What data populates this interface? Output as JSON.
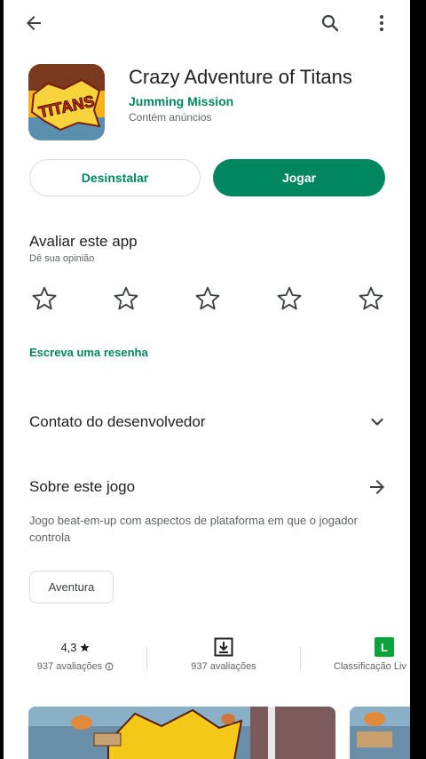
{
  "topbar": {
    "back_icon": "arrow-left-icon",
    "search_icon": "search-icon",
    "more_icon": "more-vert-icon"
  },
  "app": {
    "title": "Crazy Adventure of Titans",
    "developer": "Jumming Mission",
    "ads_note": "Contém anúncios",
    "icon_text": "TITANS"
  },
  "actions": {
    "uninstall_label": "Desinstalar",
    "play_label": "Jogar"
  },
  "rating": {
    "title": "Avaliar este app",
    "subtitle": "Dê sua opinião",
    "star_count": 5,
    "write_review": "Escreva uma resenha"
  },
  "developer_contact": {
    "label": "Contato do desenvolvedor"
  },
  "about": {
    "label": "Sobre este jogo",
    "description": "Jogo beat-em-up com aspectos de plataforma em que o jogador controla",
    "tag": "Aventura"
  },
  "stats": {
    "rating_value": "4,3",
    "rating_count": "937 avaliações",
    "downloads_label": "937 avaliações",
    "content_rating_badge": "L",
    "content_rating_label": "Classificação Liv"
  },
  "colors": {
    "accent": "#01875f",
    "badge": "#0aa33d"
  }
}
